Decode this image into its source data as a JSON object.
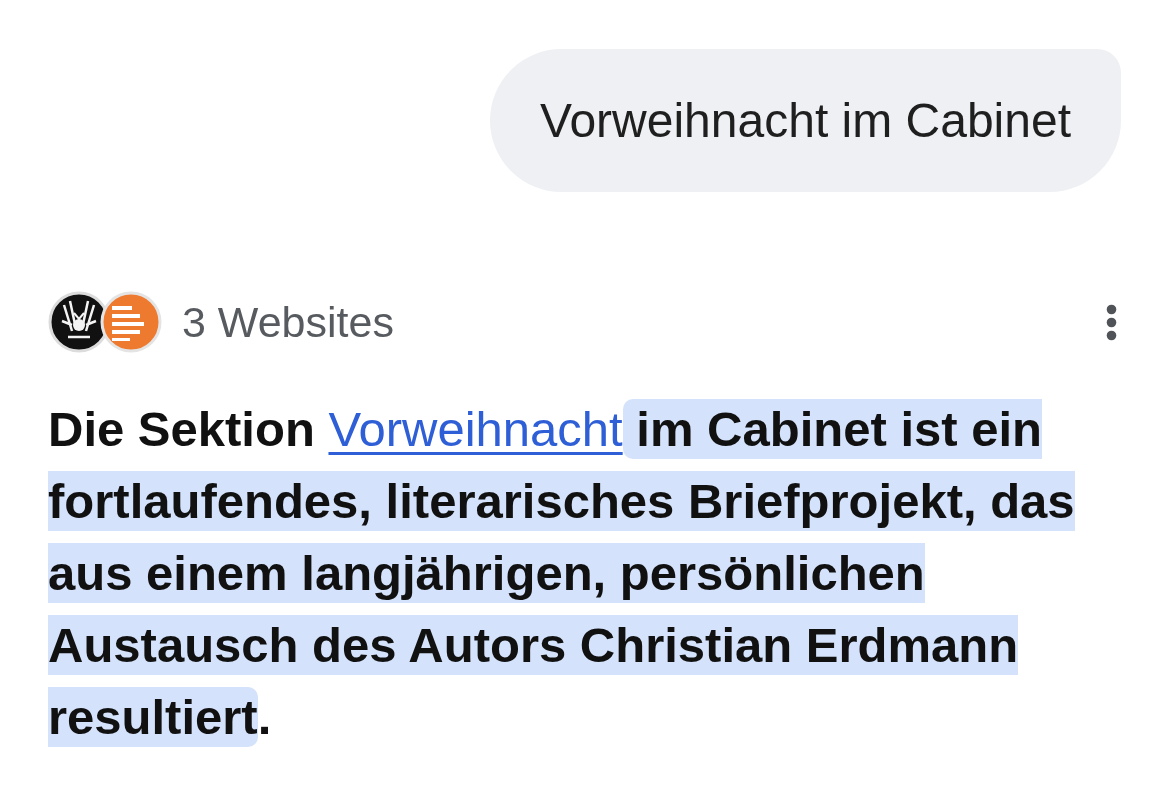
{
  "user_message": {
    "text": "Vorweihnacht im Cabinet"
  },
  "sources": {
    "label": "3 Websites"
  },
  "answer": {
    "segments": [
      {
        "kind": "text",
        "text": "Die Sektion ",
        "highlighted": false
      },
      {
        "kind": "link",
        "text": "Vorweihnacht",
        "highlighted": false
      },
      {
        "kind": "text",
        "text": " im Cabinet ist ein fortlaufendes, literarisches Briefprojekt, das aus einem langjährigen, persönlichen Austausch des Autors Christian Erdmann resultiert",
        "highlighted": true
      },
      {
        "kind": "text",
        "text": ".",
        "highlighted": false
      }
    ]
  }
}
